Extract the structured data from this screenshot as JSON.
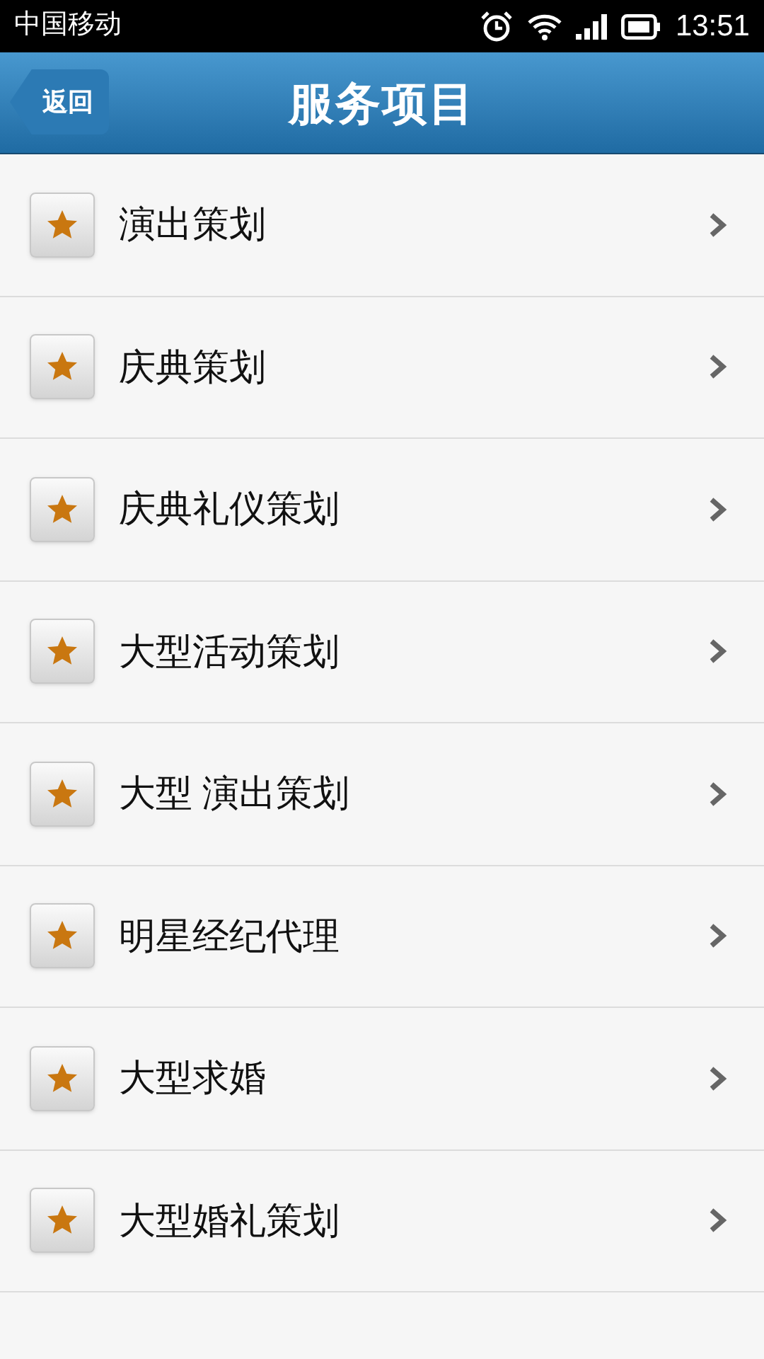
{
  "status_bar": {
    "carrier": "中国移动",
    "time": "13:51"
  },
  "header": {
    "back": "返回",
    "title": "服务项目"
  },
  "items": [
    {
      "label": "演出策划"
    },
    {
      "label": "庆典策划"
    },
    {
      "label": "庆典礼仪策划"
    },
    {
      "label": "大型活动策划"
    },
    {
      "label": "大型 演出策划"
    },
    {
      "label": "明星经纪代理"
    },
    {
      "label": "大型求婚"
    },
    {
      "label": "大型婚礼策划"
    }
  ]
}
